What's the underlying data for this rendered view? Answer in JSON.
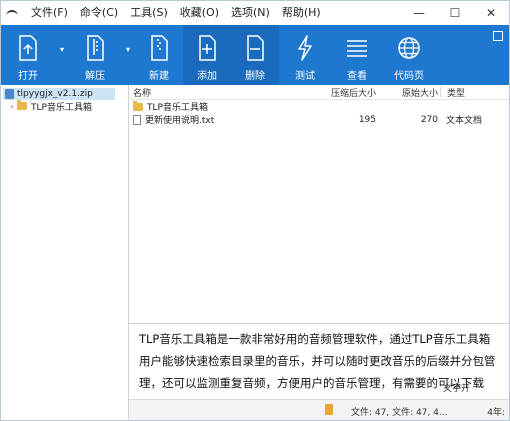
{
  "menu": [
    "文件(F)",
    "命令(C)",
    "工具(S)",
    "收藏(O)",
    "选项(N)",
    "帮助(H)"
  ],
  "toolbar": {
    "open": "打开",
    "extract": "解压",
    "new": "新建",
    "add": "添加",
    "delete": "删除",
    "test": "测试",
    "view": "查看",
    "codepage": "代码页"
  },
  "tree": {
    "root": "tlpyygjx_v2.1.zip",
    "child": "TLP音乐工具箱"
  },
  "columns": {
    "name": "名称",
    "compressed": "压缩后大小",
    "original": "原始大小",
    "type": "类型"
  },
  "files": [
    {
      "name": "TLP音乐工具箱",
      "compressed": "",
      "original": "",
      "type": ""
    },
    {
      "name": "更新使用说明.txt",
      "compressed": "195",
      "original": "270",
      "type": "文本文档"
    }
  ],
  "caption": "TLP音乐工具箱是一款非常好用的音频管理软件，通过TLP音乐工具箱用户能够快速检索目录里的音乐，并可以随时更改音乐的后缀并分包管理，还可以监测重复音频，方便用户的音乐管理，有需要的可以下载",
  "status": {
    "files": "文件: 47, 文件: 47, 4...",
    "right": "4年:"
  },
  "watermark": "文字开"
}
